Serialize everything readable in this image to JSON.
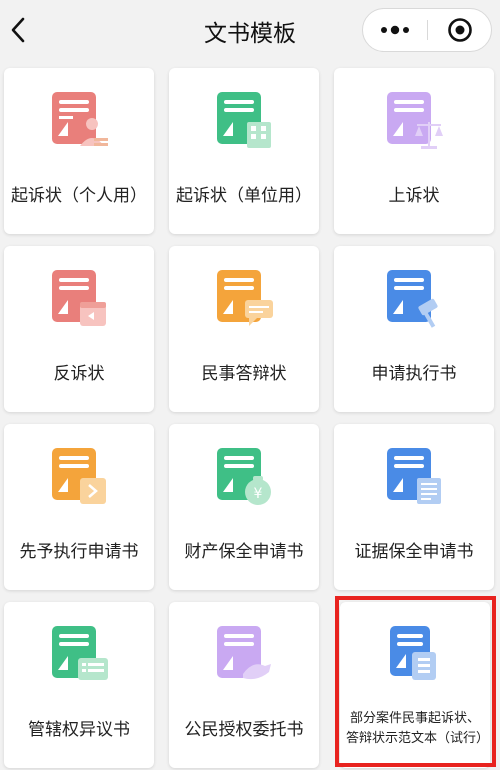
{
  "header": {
    "title": "文书模板"
  },
  "templates": [
    {
      "label": "起诉状（个人用）",
      "icon": "complaint-personal-icon",
      "color": "#e97f7b"
    },
    {
      "label": "起诉状（单位用）",
      "icon": "complaint-company-icon",
      "color": "#3fbf86"
    },
    {
      "label": "上诉状",
      "icon": "appeal-scale-icon",
      "color": "#c9a9f2"
    },
    {
      "label": "反诉状",
      "icon": "counterclaim-calendar-icon",
      "color": "#e97f7b"
    },
    {
      "label": "民事答辩状",
      "icon": "defense-chat-icon",
      "color": "#f4a43b"
    },
    {
      "label": "申请执行书",
      "icon": "enforcement-gavel-icon",
      "color": "#4a8be6"
    },
    {
      "label": "先予执行申请书",
      "icon": "advance-enforcement-icon",
      "color": "#f4a43b"
    },
    {
      "label": "财产保全申请书",
      "icon": "property-preservation-icon",
      "color": "#3fbf86"
    },
    {
      "label": "证据保全申请书",
      "icon": "evidence-preservation-icon",
      "color": "#4a8be6"
    },
    {
      "label": "管辖权异议书",
      "icon": "jurisdiction-objection-icon",
      "color": "#3fbf86"
    },
    {
      "label": "公民授权委托书",
      "icon": "citizen-authorization-icon",
      "color": "#c9a9f2"
    },
    {
      "label": "部分案件民事起诉状、答辩状示范文本（试行）",
      "icon": "sample-text-icon",
      "color": "#4a8be6"
    }
  ]
}
